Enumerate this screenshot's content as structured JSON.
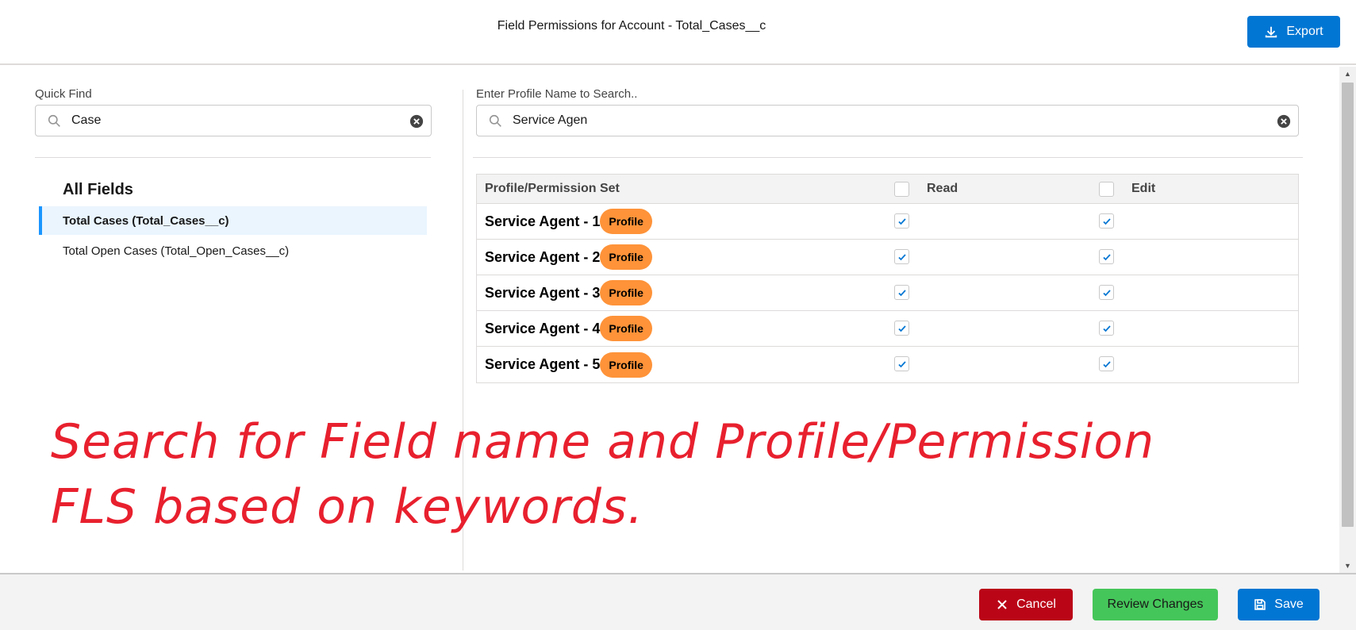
{
  "header": {
    "title": "Field Permissions for Account - Total_Cases__c",
    "export_label": "Export"
  },
  "left": {
    "quick_find_label": "Quick Find",
    "quick_find_value": "Case",
    "all_fields_heading": "All Fields",
    "fields": [
      {
        "label": "Total Cases (Total_Cases__c)",
        "active": true
      },
      {
        "label": "Total Open Cases (Total_Open_Cases__c)",
        "active": false
      }
    ]
  },
  "right": {
    "profile_search_label": "Enter Profile Name to Search..",
    "profile_search_value": "Service Agen",
    "table": {
      "headers": {
        "name": "Profile/Permission Set",
        "read": "Read",
        "edit": "Edit"
      },
      "rows": [
        {
          "name": "Service Agent - 1",
          "badge": "Profile",
          "read": true,
          "edit": true
        },
        {
          "name": "Service Agent - 2",
          "badge": "Profile",
          "read": true,
          "edit": true
        },
        {
          "name": "Service Agent - 3",
          "badge": "Profile",
          "read": true,
          "edit": true
        },
        {
          "name": "Service Agent - 4",
          "badge": "Profile",
          "read": true,
          "edit": true
        },
        {
          "name": "Service Agent - 5",
          "badge": "Profile",
          "read": true,
          "edit": true
        }
      ]
    }
  },
  "annotation": {
    "line1": "Search for Field name and Profile/Permission",
    "line2": "FLS based on keywords."
  },
  "footer": {
    "cancel_label": "Cancel",
    "review_label": "Review Changes",
    "save_label": "Save"
  },
  "colors": {
    "brand": "#0176d3",
    "cancel": "#ba0517",
    "review": "#45c65a",
    "badge": "#fe9339",
    "annotation": "#e8202e"
  },
  "icons": {
    "export": "download-icon",
    "search": "search-icon",
    "clear": "clear-icon",
    "check": "check-icon",
    "cancel": "close-icon",
    "save": "save-icon"
  }
}
